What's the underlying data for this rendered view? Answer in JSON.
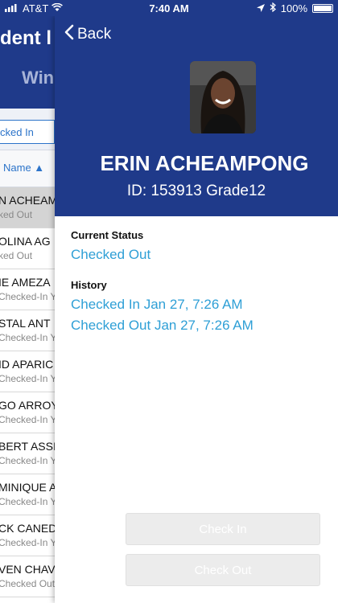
{
  "status_bar": {
    "carrier": "AT&T",
    "time": "7:40 AM",
    "battery": "100%"
  },
  "background_list": {
    "title_partial": "dent l",
    "subtitle_partial": "Win",
    "filter_label_partial": "cked In",
    "sort_label_partial": "Name ▲",
    "rows": [
      {
        "name": "N ACHEAM",
        "status": "ked Out",
        "selected": true
      },
      {
        "name": "OLINA AG",
        "status": "ked Out",
        "selected": false
      },
      {
        "name": "IE AMEZA",
        "status": "Checked-In Y",
        "selected": false
      },
      {
        "name": "STAL ANT",
        "status": "Checked-In Y",
        "selected": false
      },
      {
        "name": "ID APARIC",
        "status": "Checked-In Y",
        "selected": false
      },
      {
        "name": "GO ARROY",
        "status": "Checked-In Y",
        "selected": false
      },
      {
        "name": "BERT ASSI",
        "status": "Checked-In Y",
        "selected": false
      },
      {
        "name": "MINIQUE A",
        "status": "Checked-In Y",
        "selected": false
      },
      {
        "name": "CK CANED",
        "status": "Checked-In Y",
        "selected": false
      },
      {
        "name": "VEN CHAV",
        "status": "Checked Out",
        "selected": false
      }
    ]
  },
  "detail": {
    "back_label": "Back",
    "student_name": "ERIN ACHEAMPONG",
    "id_line": "ID: 153913  Grade12",
    "current_status_label": "Current Status",
    "current_status_value": "Checked Out",
    "history_label": "History",
    "history": [
      "Checked In Jan 27, 7:26 AM",
      "Checked Out Jan 27, 7:26 AM"
    ],
    "check_in_label": "Check In",
    "check_out_label": "Check Out"
  },
  "colors": {
    "header_blue": "#1f3a8a",
    "link_blue": "#2e9fd6",
    "disabled_button": "#ececec"
  }
}
